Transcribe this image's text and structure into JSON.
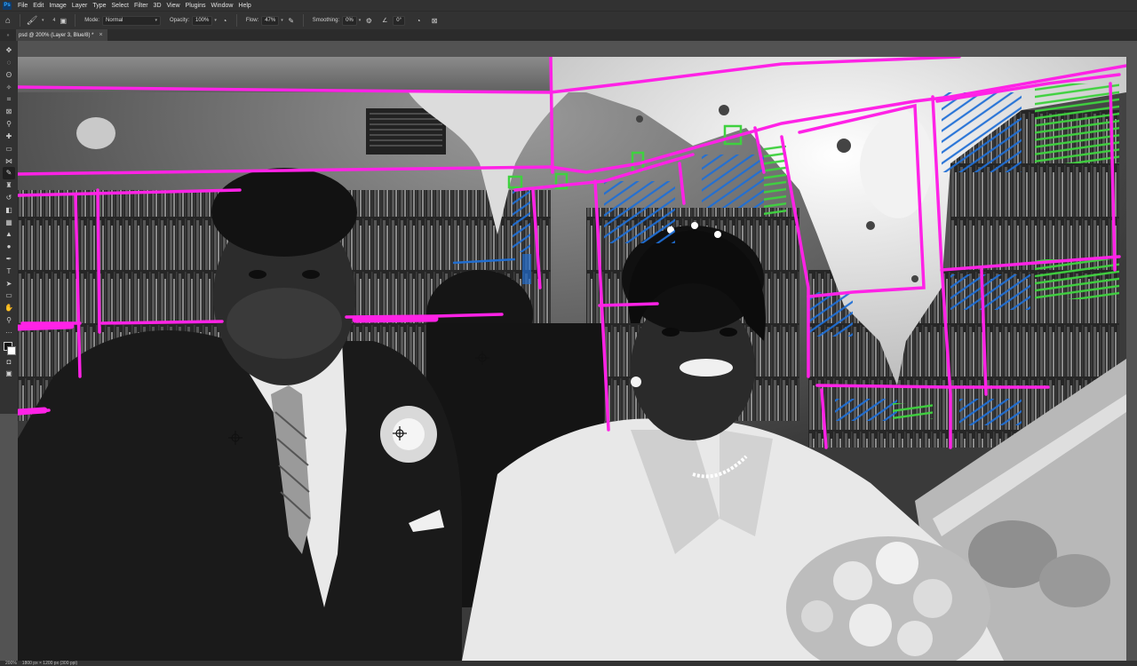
{
  "app": {
    "logo": "Ps"
  },
  "menu": [
    "File",
    "Edit",
    "Image",
    "Layer",
    "Type",
    "Select",
    "Filter",
    "3D",
    "View",
    "Plugins",
    "Window",
    "Help"
  ],
  "options": {
    "brush_size": "4",
    "mode_label": "Mode:",
    "mode_value": "Normal",
    "opacity_label": "Opacity:",
    "opacity_value": "100%",
    "flow_label": "Flow:",
    "flow_value": "47%",
    "smoothing_label": "Smoothing:",
    "smoothing_value": "0%",
    "angle_value": "0°"
  },
  "tab": {
    "grip": "»",
    "title": "psd @ 200% (Layer 3, Blue/8) *",
    "close": "×"
  },
  "toolbar": {
    "tools": [
      "move-tool",
      "marquee-tool",
      "lasso-tool",
      "quick-select-tool",
      "crop-tool",
      "frame-tool",
      "eyedropper-tool",
      "healing-tool",
      "brush-tool",
      "clone-stamp-tool",
      "history-brush-tool",
      "eraser-tool",
      "gradient-tool",
      "blur-tool",
      "dodge-tool",
      "pen-tool",
      "type-tool",
      "path-select-tool",
      "shape-tool",
      "hand-tool",
      "zoom-tool",
      "more-tools"
    ],
    "active_tool": "brush-tool"
  },
  "statusbar": {
    "zoom": "200%",
    "doc_info": "1800 px × 1200 px (300 ppi)"
  },
  "colors": {
    "guide_magenta": "#ff22e6",
    "hatch_blue": "#1f6fd6",
    "hatch_green": "#3fd13f"
  }
}
